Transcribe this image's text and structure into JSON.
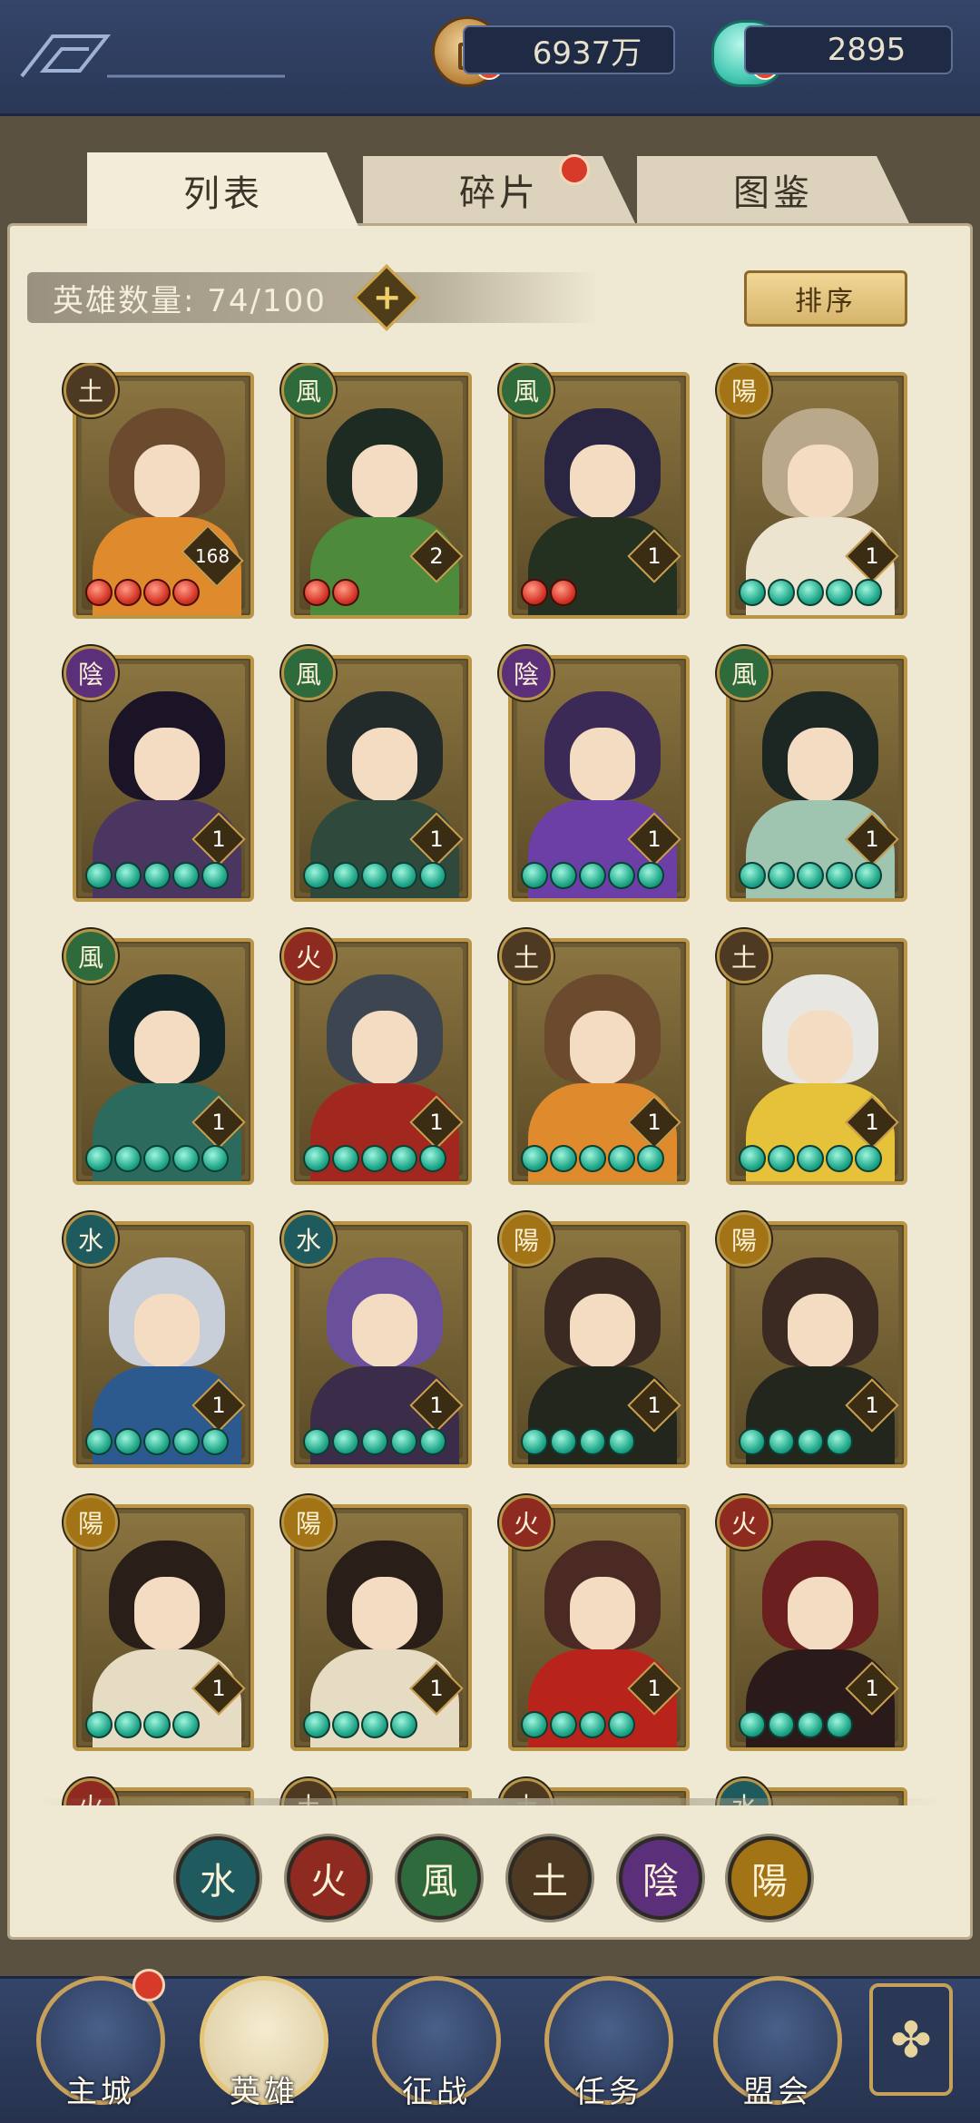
{
  "currencies": {
    "coins": "6937万",
    "gems": "2895"
  },
  "tabs": [
    {
      "label": "列表",
      "active": true
    },
    {
      "label": "碎片",
      "active": false,
      "has_notification": true
    },
    {
      "label": "图鉴",
      "active": false
    }
  ],
  "hero_count": "英雄数量: 74/100",
  "sort_label": "排序",
  "colors": {
    "earth": "#4e3a22",
    "wind": "#2f6a3d",
    "yang": "#a37416",
    "yin": "#5b2f7a",
    "fire": "#8e2a1f",
    "water": "#1f5a5e"
  },
  "heroes": [
    {
      "element": "土",
      "level": "168",
      "stars": 4,
      "star_color": "red"
    },
    {
      "element": "風",
      "level": "2",
      "stars": 2,
      "star_color": "red"
    },
    {
      "element": "風",
      "level": "1",
      "stars": 2,
      "star_color": "red"
    },
    {
      "element": "陽",
      "level": "1",
      "stars": 5,
      "star_color": "green"
    },
    {
      "element": "陰",
      "level": "1",
      "stars": 5,
      "star_color": "green"
    },
    {
      "element": "風",
      "level": "1",
      "stars": 5,
      "star_color": "green"
    },
    {
      "element": "陰",
      "level": "1",
      "stars": 5,
      "star_color": "green"
    },
    {
      "element": "風",
      "level": "1",
      "stars": 5,
      "star_color": "green"
    },
    {
      "element": "風",
      "level": "1",
      "stars": 5,
      "star_color": "green"
    },
    {
      "element": "火",
      "level": "1",
      "stars": 5,
      "star_color": "green"
    },
    {
      "element": "土",
      "level": "1",
      "stars": 5,
      "star_color": "green"
    },
    {
      "element": "土",
      "level": "1",
      "stars": 5,
      "star_color": "green"
    },
    {
      "element": "水",
      "level": "1",
      "stars": 5,
      "star_color": "green"
    },
    {
      "element": "水",
      "level": "1",
      "stars": 5,
      "star_color": "green"
    },
    {
      "element": "陽",
      "level": "1",
      "stars": 4,
      "star_color": "green"
    },
    {
      "element": "陽",
      "level": "1",
      "stars": 4,
      "star_color": "green"
    },
    {
      "element": "陽",
      "level": "1",
      "stars": 4,
      "star_color": "green"
    },
    {
      "element": "陽",
      "level": "1",
      "stars": 4,
      "star_color": "green"
    },
    {
      "element": "火",
      "level": "1",
      "stars": 4,
      "star_color": "green"
    },
    {
      "element": "火",
      "level": "1",
      "stars": 4,
      "star_color": "green"
    },
    {
      "element": "火",
      "level": "",
      "stars": 0,
      "star_color": "green"
    },
    {
      "element": "土",
      "level": "",
      "stars": 0,
      "star_color": "green"
    },
    {
      "element": "土",
      "level": "",
      "stars": 0,
      "star_color": "green"
    },
    {
      "element": "水",
      "level": "",
      "stars": 0,
      "star_color": "green"
    }
  ],
  "element_filters": [
    {
      "label": "水",
      "key": "water"
    },
    {
      "label": "火",
      "key": "fire"
    },
    {
      "label": "風",
      "key": "wind"
    },
    {
      "label": "土",
      "key": "earth"
    },
    {
      "label": "陰",
      "key": "yin"
    },
    {
      "label": "陽",
      "key": "yang"
    }
  ],
  "bottom_nav": [
    {
      "label": "主城",
      "icon": "castle-icon",
      "active": false,
      "has_notification": true
    },
    {
      "label": "英雄",
      "icon": "hero-portrait-icon",
      "active": true
    },
    {
      "label": "征战",
      "icon": "battle-icon",
      "active": false
    },
    {
      "label": "任务",
      "icon": "scroll-icon",
      "active": false
    },
    {
      "label": "盟会",
      "icon": "alliance-icon",
      "active": false
    }
  ],
  "menu_icon": "clover-menu-icon"
}
